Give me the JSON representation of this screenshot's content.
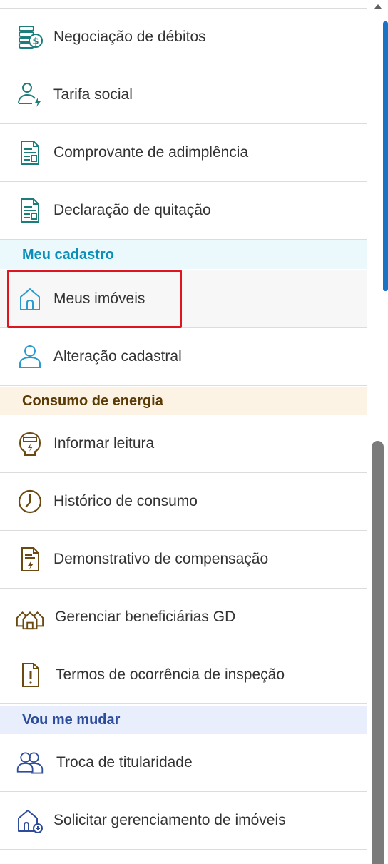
{
  "menu": {
    "items_a": [
      {
        "label": "Negociação de débitos",
        "icon": "money-stack-icon"
      },
      {
        "label": "Tarifa social",
        "icon": "user-energy-icon"
      },
      {
        "label": "Comprovante de adimplência",
        "icon": "document-icon"
      },
      {
        "label": "Declaração de quitação",
        "icon": "document-icon"
      }
    ],
    "section_cadastro": {
      "title": "Meu cadastro",
      "color": "#0a8fb8",
      "background": "#ebf8fc"
    },
    "items_b": [
      {
        "label": "Meus imóveis",
        "icon": "house-icon",
        "selected": true
      },
      {
        "label": "Alteração cadastral",
        "icon": "user-icon"
      }
    ],
    "section_consumo": {
      "title": "Consumo de energia",
      "color": "#5a3a05",
      "background": "#fcf3e4"
    },
    "items_c": [
      {
        "label": "Informar leitura",
        "icon": "meter-icon"
      },
      {
        "label": "Histórico de consumo",
        "icon": "clock-icon"
      },
      {
        "label": "Demonstrativo de compensação",
        "icon": "energy-document-icon"
      },
      {
        "label": "Gerenciar beneficiárias GD",
        "icon": "houses-icon"
      },
      {
        "label": "Termos de ocorrência de inspeção",
        "icon": "alert-document-icon"
      }
    ],
    "section_mudar": {
      "title": "Vou me mudar",
      "color": "#2e4c9c",
      "background": "#e8eefc"
    },
    "items_d": [
      {
        "label": "Troca de titularidade",
        "icon": "users-icon"
      },
      {
        "label": "Solicitar gerenciamento de imóveis",
        "icon": "house-add-icon"
      }
    ]
  },
  "colors": {
    "teal": "#1c7e7a",
    "blue": "#2a9bd0",
    "brown": "#6b4a12",
    "navy": "#2e4c9c",
    "highlight": "#e0141e"
  }
}
